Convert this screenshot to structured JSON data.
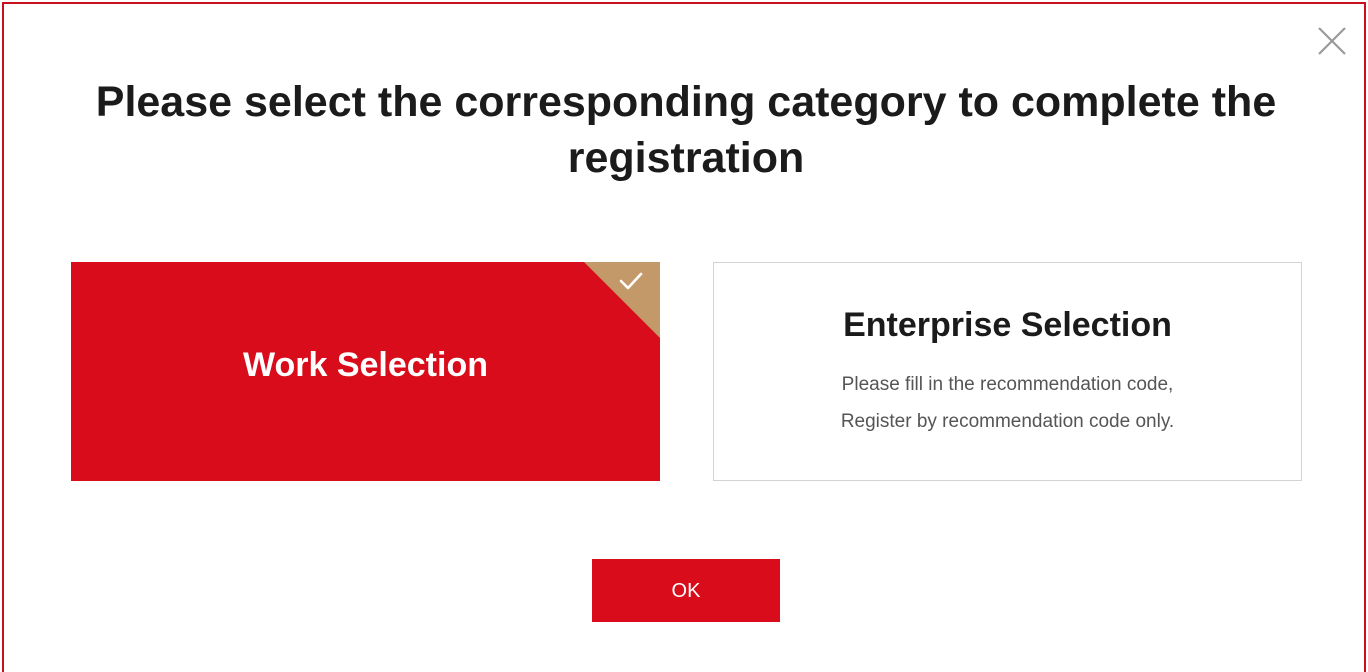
{
  "dialog": {
    "title": "Please select the corresponding category to complete the registration",
    "close_icon": "close-icon"
  },
  "options": [
    {
      "title": "Work Selection",
      "selected": true,
      "selected_icon": "checkmark-icon"
    },
    {
      "title": "Enterprise Selection",
      "selected": false,
      "description_lines": [
        "Please fill in the recommendation code,",
        "Register by recommendation code only."
      ]
    }
  ],
  "footer": {
    "ok_label": "OK"
  },
  "colors": {
    "accent": "#d80c1a",
    "dialog_border": "#c8101e",
    "selected_corner": "#c4996a",
    "card_border": "#d3d3d3",
    "title_text": "#1b1b1b",
    "description_text": "#555555"
  }
}
